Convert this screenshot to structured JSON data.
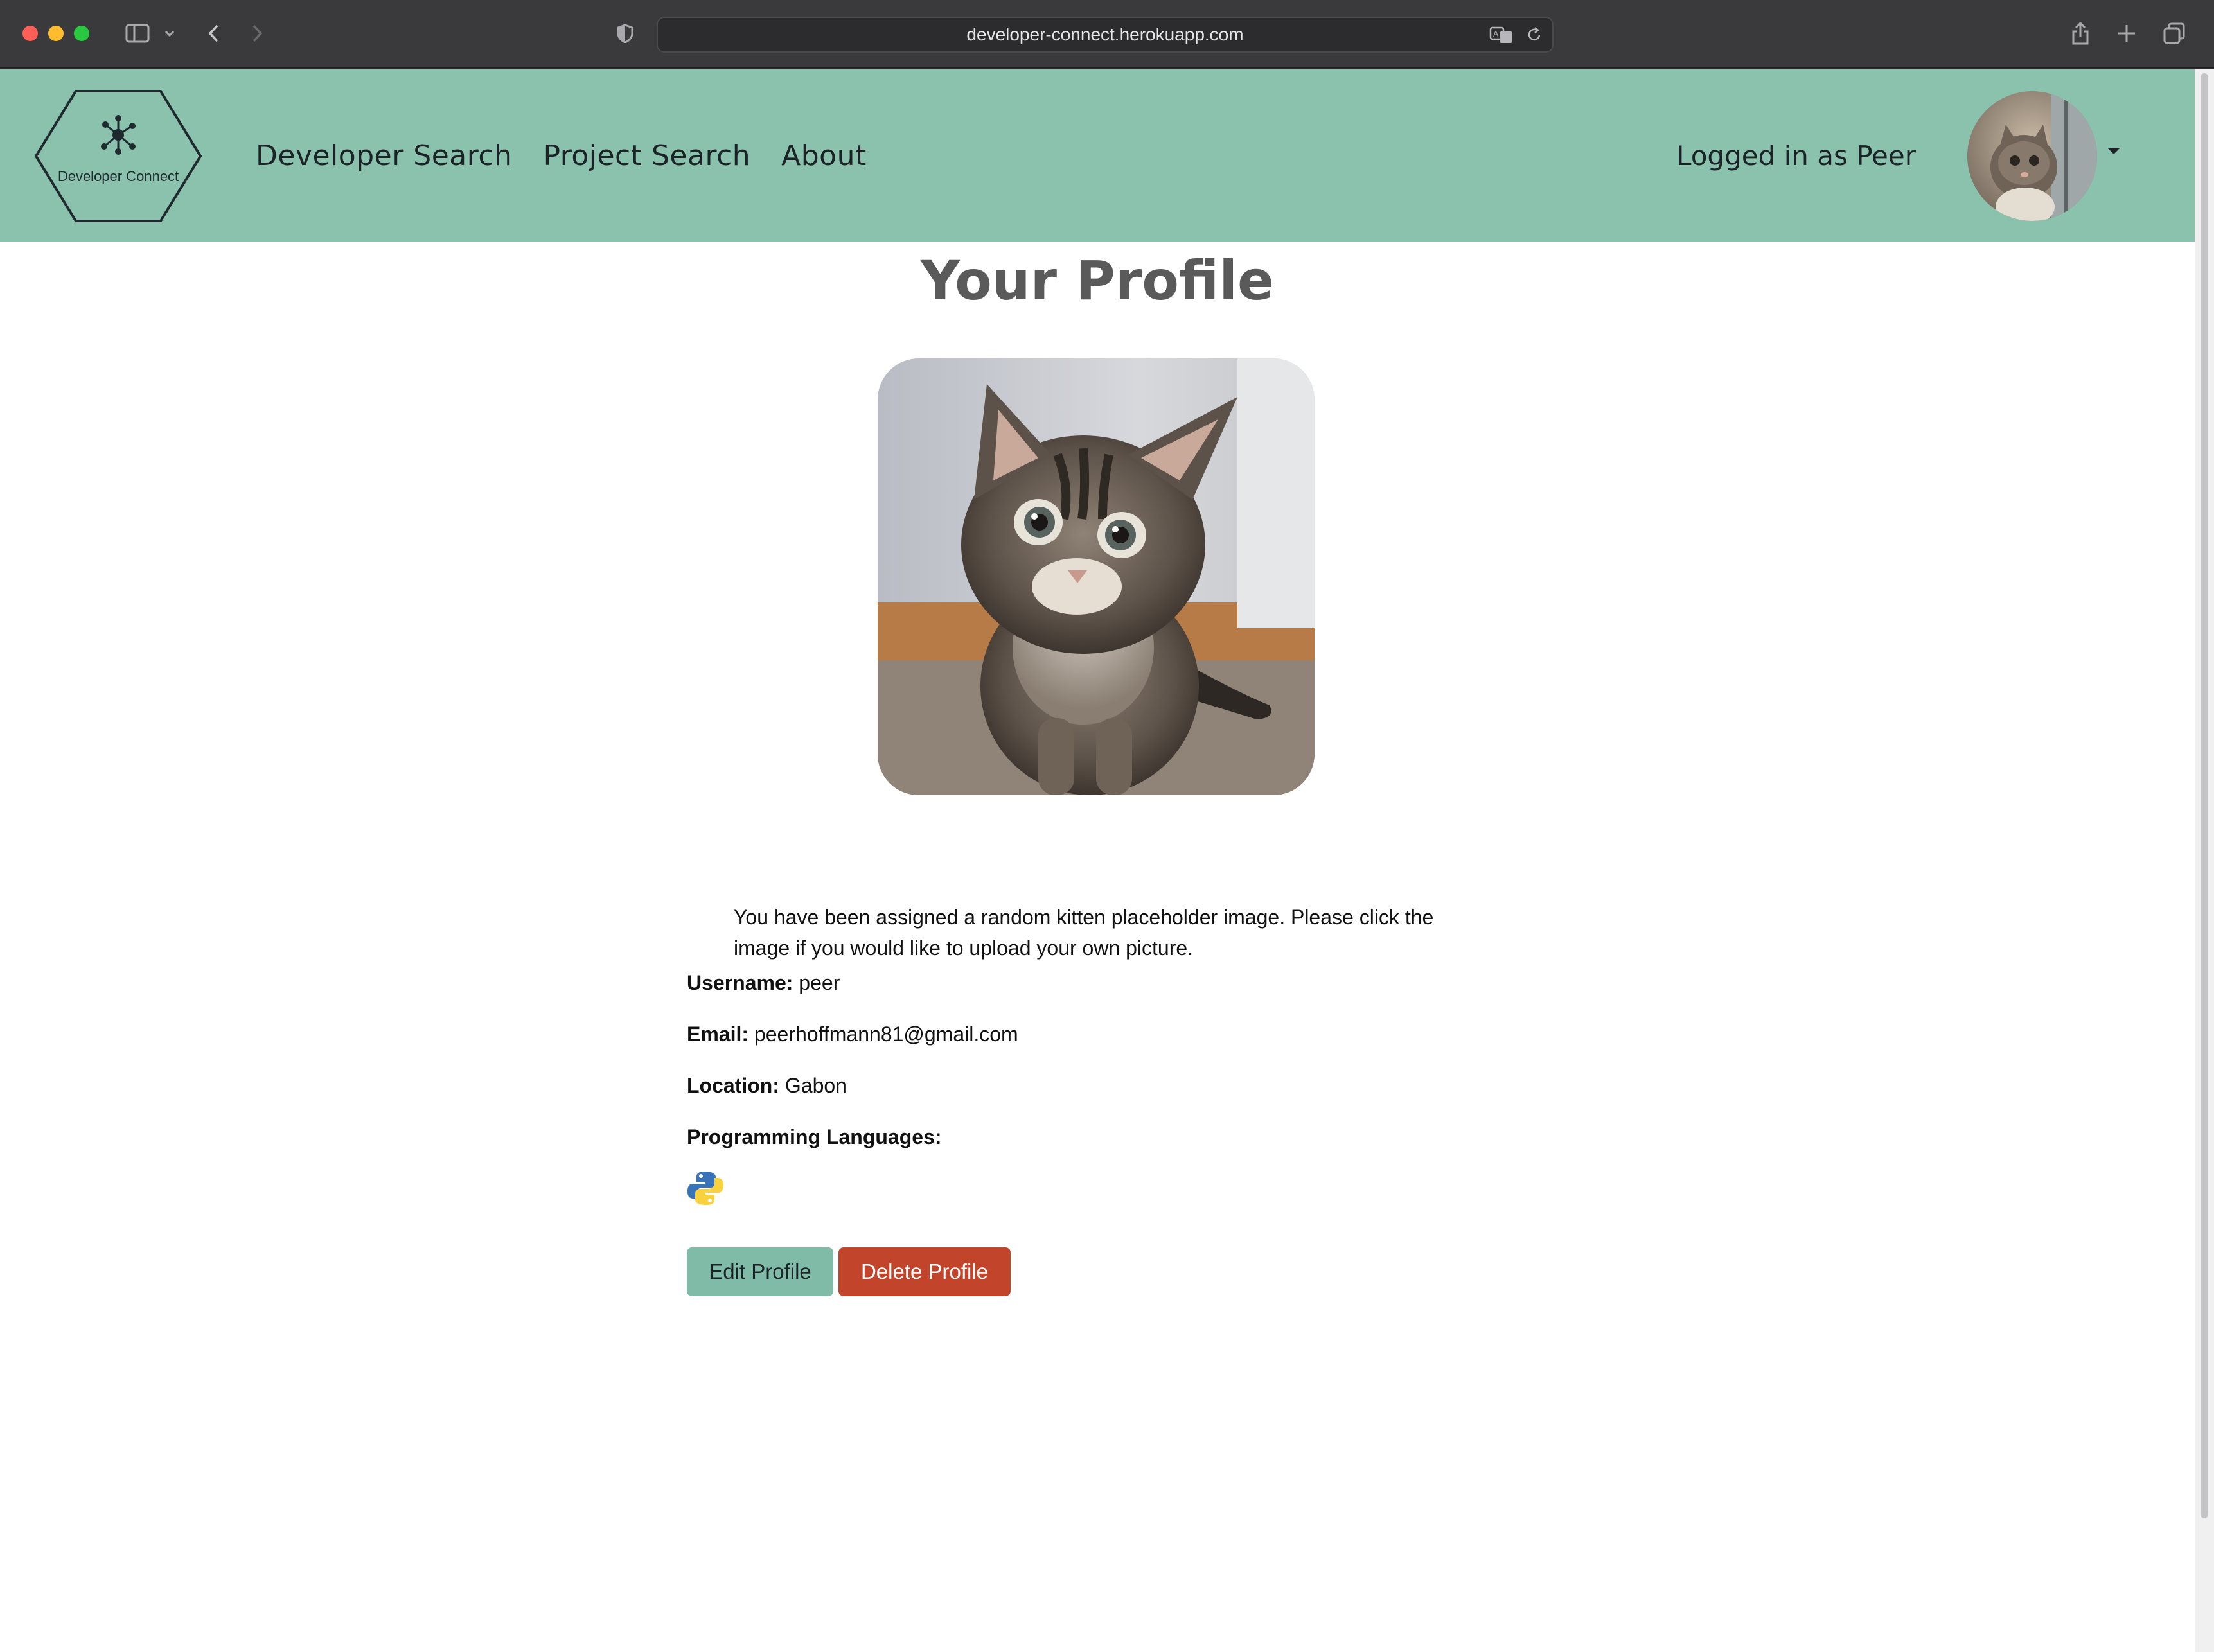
{
  "browser": {
    "url": "developer-connect.herokuapp.com"
  },
  "nav": {
    "logo_text": "Developer Connect",
    "links": [
      "Developer Search",
      "Project Search",
      "About"
    ],
    "logged_in_text": "Logged in as Peer"
  },
  "profile": {
    "title": "Your Profile",
    "notice": "You have been assigned a random kitten placeholder image. Please click the image if you would like to upload your own picture.",
    "username_label": "Username:",
    "username": "peer",
    "email_label": "Email:",
    "email": "peerhoffmann81@gmail.com",
    "location_label": "Location:",
    "location": "Gabon",
    "languages_label": "Programming Languages:",
    "languages": [
      "python-icon"
    ],
    "edit_button": "Edit Profile",
    "delete_button": "Delete Profile"
  },
  "colors": {
    "navbar": "#8bc2ad",
    "edit_button": "#7fbba6",
    "delete_button": "#c2452b"
  }
}
